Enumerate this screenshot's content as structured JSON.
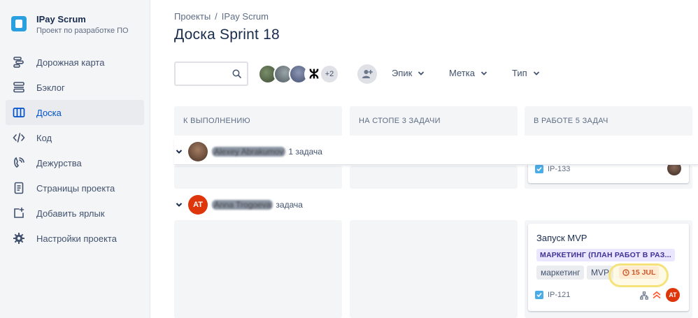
{
  "project": {
    "name": "IPay Scrum",
    "subtitle": "Проект по разработке ПО"
  },
  "sidebar": {
    "items": [
      {
        "label": "Дорожная карта",
        "icon": "roadmap-icon"
      },
      {
        "label": "Бэклог",
        "icon": "backlog-icon"
      },
      {
        "label": "Доска",
        "icon": "board-icon",
        "active": true
      },
      {
        "label": "Код",
        "icon": "code-icon"
      },
      {
        "label": "Дежурства",
        "icon": "phone-icon"
      },
      {
        "label": "Страницы проекта",
        "icon": "pages-icon"
      },
      {
        "label": "Добавить ярлык",
        "icon": "add-shortcut-icon"
      },
      {
        "label": "Настройки проекта",
        "icon": "gear-icon"
      }
    ]
  },
  "breadcrumb": {
    "root": "Проекты",
    "sep": "/",
    "current": "IPay Scrum"
  },
  "title": "Доска Sprint 18",
  "toolbar": {
    "avatars_more": "+2",
    "filters": [
      "Эпик",
      "Метка",
      "Тип"
    ]
  },
  "columns": [
    {
      "label": "К ВЫПОЛНЕНИЮ"
    },
    {
      "label": "НА СТОПЕ 3 ЗАДАЧИ"
    },
    {
      "label": "В РАБОТЕ 5 ЗАДАЧ"
    }
  ],
  "swimlanes": [
    {
      "name": "Alexey Abrakumov",
      "count": "1 задача",
      "avatar": "photo"
    },
    {
      "name": "Anna Trogoeva",
      "count": "задача",
      "avatar_initials": "AT",
      "avatar_color": "#de350b"
    }
  ],
  "cards": {
    "partial": {
      "key": "IP-133"
    },
    "main": {
      "title": "Запуск MVP",
      "epic": "МАРКЕТИНГ (ПЛАН РАБОТ В РАЗ...",
      "labels": [
        "маркетинг",
        "MVP"
      ],
      "due": "15 JUL",
      "key": "IP-121",
      "assignee": "AT"
    }
  },
  "colors": {
    "accent": "#0052cc",
    "epic_bg": "#eae6ff",
    "due_bg": "#ffebe6",
    "highlight": "#f5e27a"
  }
}
